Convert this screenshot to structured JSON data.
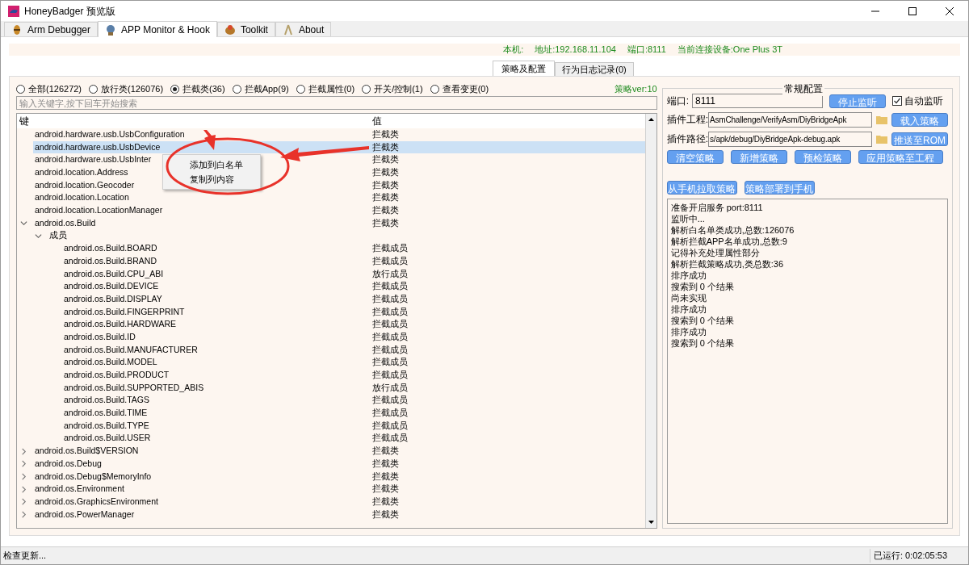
{
  "window": {
    "title": "HoneyBadger 预览版"
  },
  "tabs": [
    {
      "label": "Arm Debugger",
      "selected": false
    },
    {
      "label": "APP Monitor & Hook",
      "selected": true
    },
    {
      "label": "Toolkit",
      "selected": false
    },
    {
      "label": "About",
      "selected": false
    }
  ],
  "info_bar": [
    "本机:",
    "地址:192.168.11.104",
    "端口:8111",
    "当前连接设备:One Plus 3T"
  ],
  "sub_tabs": [
    {
      "label": "策略及配置",
      "selected": true
    },
    {
      "label": "行为日志记录(0)",
      "selected": false
    }
  ],
  "filters": [
    {
      "label": "全部(126272)",
      "selected": false
    },
    {
      "label": "放行类(126076)",
      "selected": false
    },
    {
      "label": "拦截类(36)",
      "selected": true
    },
    {
      "label": "拦截App(9)",
      "selected": false
    },
    {
      "label": "拦截属性(0)",
      "selected": false
    },
    {
      "label": "开关/控制(1)",
      "selected": false
    },
    {
      "label": "查看变更(0)",
      "selected": false
    }
  ],
  "policy_version": "策略ver:10",
  "search": {
    "placeholder": "输入关键字,按下回车开始搜索"
  },
  "tree": {
    "columns": [
      "键",
      "值"
    ],
    "rows": [
      {
        "key": "android.hardware.usb.UsbConfiguration",
        "value": "拦截类",
        "selected": false
      },
      {
        "key": "android.hardware.usb.UsbDevice",
        "value": "拦截类",
        "selected": true
      },
      {
        "key": "android.hardware.usb.UsbInter",
        "value": "拦截类",
        "selected": false
      },
      {
        "key": "android.location.Address",
        "value": "拦截类",
        "selected": false
      },
      {
        "key": "android.location.Geocoder",
        "value": "拦截类",
        "selected": false
      },
      {
        "key": "android.location.Location",
        "value": "拦截类",
        "selected": false
      },
      {
        "key": "android.location.LocationManager",
        "value": "拦截类",
        "selected": false
      },
      {
        "key": "android.os.Build",
        "value": "拦截类",
        "selected": false,
        "expanded": true,
        "children": [
          {
            "key": "成员",
            "selected": false,
            "expanded": true,
            "children": [
              {
                "key": "android.os.Build.BOARD",
                "value": "拦截成员",
                "selected": false
              },
              {
                "key": "android.os.Build.BRAND",
                "value": "拦截成员",
                "selected": false
              },
              {
                "key": "android.os.Build.CPU_ABI",
                "value": "放行成员",
                "selected": false
              },
              {
                "key": "android.os.Build.DEVICE",
                "value": "拦截成员",
                "selected": false
              },
              {
                "key": "android.os.Build.DISPLAY",
                "value": "拦截成员",
                "selected": false
              },
              {
                "key": "android.os.Build.FINGERPRINT",
                "value": "拦截成员",
                "selected": false
              },
              {
                "key": "android.os.Build.HARDWARE",
                "value": "拦截成员",
                "selected": false
              },
              {
                "key": "android.os.Build.ID",
                "value": "拦截成员",
                "selected": false
              },
              {
                "key": "android.os.Build.MANUFACTURER",
                "value": "拦截成员",
                "selected": false
              },
              {
                "key": "android.os.Build.MODEL",
                "value": "拦截成员",
                "selected": false
              },
              {
                "key": "android.os.Build.PRODUCT",
                "value": "拦截成员",
                "selected": false
              },
              {
                "key": "android.os.Build.SUPPORTED_ABIS",
                "value": "放行成员",
                "selected": false
              },
              {
                "key": "android.os.Build.TAGS",
                "value": "拦截成员",
                "selected": false
              },
              {
                "key": "android.os.Build.TIME",
                "value": "拦截成员",
                "selected": false
              },
              {
                "key": "android.os.Build.TYPE",
                "value": "拦截成员",
                "selected": false
              },
              {
                "key": "android.os.Build.USER",
                "value": "拦截成员",
                "selected": false
              }
            ]
          }
        ]
      },
      {
        "key": "android.os.Build$VERSION",
        "value": "拦截类",
        "selected": false,
        "expanded": false
      },
      {
        "key": "android.os.Debug",
        "value": "拦截类",
        "selected": false,
        "expanded": false
      },
      {
        "key": "android.os.Debug$MemoryInfo",
        "value": "拦截类",
        "selected": false,
        "expanded": false
      },
      {
        "key": "android.os.Environment",
        "value": "拦截类",
        "selected": false,
        "expanded": false
      },
      {
        "key": "android.os.GraphicsEnvironment",
        "value": "拦截类",
        "selected": false,
        "expanded": false
      },
      {
        "key": "android.os.PowerManager",
        "value": "拦截类",
        "selected": false,
        "expanded": false
      }
    ]
  },
  "context_menu": [
    "添加到白名单",
    "复制列内容"
  ],
  "config": {
    "title": "常规配置",
    "port_label": "端口:",
    "port": "8111",
    "stop_button": "停止监听",
    "auto_listen": {
      "label": "自动监听",
      "checked": true
    },
    "project_label": "插件工程:",
    "project_path": "AsmChallenge/VerifyAsm/DiyBridgeApk",
    "load_button": "载入策略",
    "plugin_label": "插件路径:",
    "plugin_path": "s/apk/debug/DiyBridgeApk-debug.apk",
    "push_button": "推送至ROM",
    "action_buttons": [
      "清空策略",
      "新增策略",
      "预检策略",
      "应用策略至工程"
    ],
    "phone_buttons": [
      "从手机拉取策略",
      "策略部署到手机"
    ],
    "log": [
      "准备开启服务 port:8111",
      "监听中...",
      "解析白名单类成功,总数:126076",
      "解析拦截APP名单成功,总数:9",
      "记得补充处理属性部分",
      "解析拦截策略成功,类总数:36",
      "排序成功",
      "搜索到 0 个结果",
      "尚未实现",
      "排序成功",
      "搜索到 0 个结果",
      "排序成功",
      "搜索到 0 个结果"
    ]
  },
  "status_bar": {
    "left": "检查更新...",
    "right": "已运行: 0:02:05:53"
  }
}
